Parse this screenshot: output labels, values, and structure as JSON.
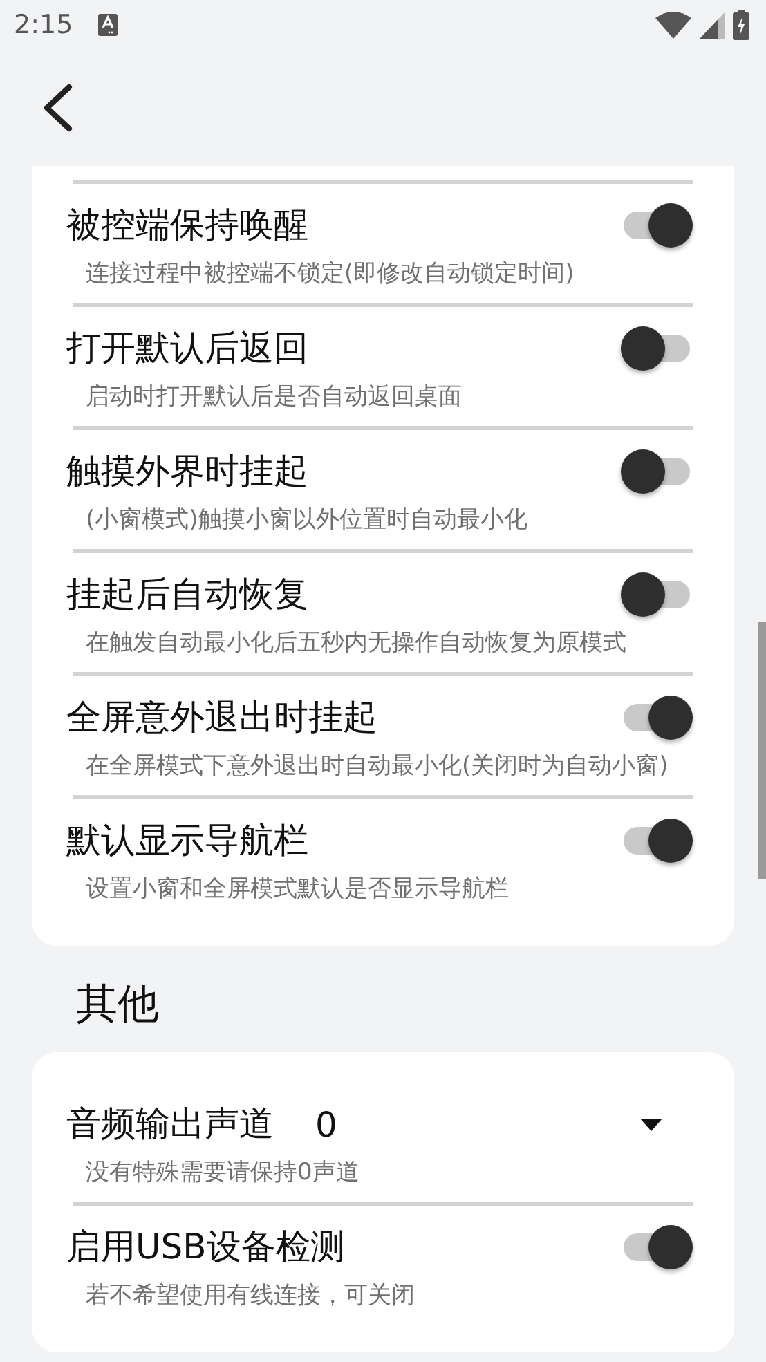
{
  "status_bar": {
    "time": "2:15"
  },
  "sections": [
    {
      "items": [
        {
          "kind": "switch",
          "title": "被控端保持唤醒",
          "subtitle": "连接过程中被控端不锁定(即修改自动锁定时间)",
          "on": true
        },
        {
          "kind": "switch",
          "title": "打开默认后返回",
          "subtitle": "启动时打开默认后是否自动返回桌面",
          "on": false
        },
        {
          "kind": "switch",
          "title": "触摸外界时挂起",
          "subtitle": "(小窗模式)触摸小窗以外位置时自动最小化",
          "on": false
        },
        {
          "kind": "switch",
          "title": "挂起后自动恢复",
          "subtitle": "在触发自动最小化后五秒内无操作自动恢复为原模式",
          "on": false
        },
        {
          "kind": "switch",
          "title": "全屏意外退出时挂起",
          "subtitle": "在全屏模式下意外退出时自动最小化(关闭时为自动小窗)",
          "on": true
        },
        {
          "kind": "switch",
          "title": "默认显示导航栏",
          "subtitle": "设置小窗和全屏模式默认是否显示导航栏",
          "on": true
        }
      ]
    },
    {
      "header": "其他",
      "items": [
        {
          "kind": "dropdown",
          "title": "音频输出声道",
          "value": "0",
          "subtitle": "没有特殊需要请保持0声道"
        },
        {
          "kind": "switch",
          "title": "启用USB设备检测",
          "subtitle": "若不希望使用有线连接，可关闭",
          "on": true
        }
      ]
    }
  ]
}
